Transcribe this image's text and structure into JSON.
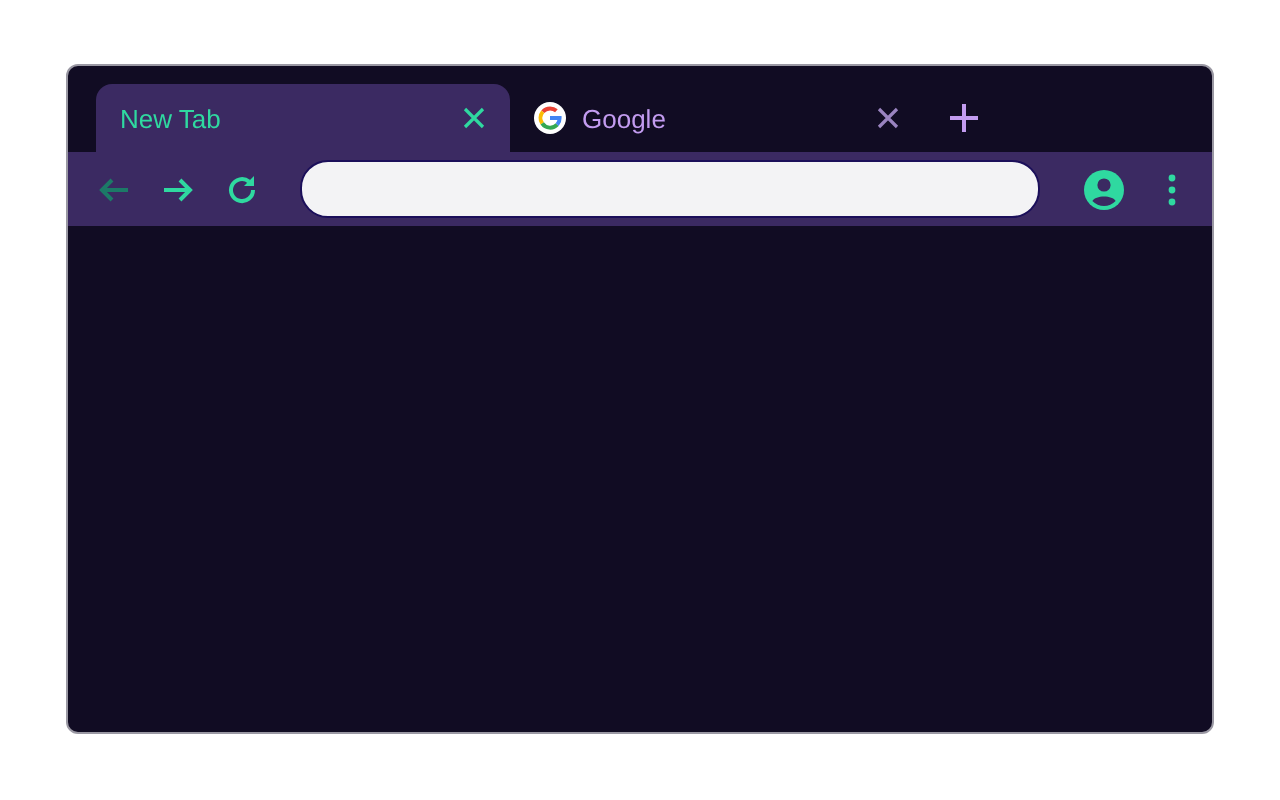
{
  "tabs": [
    {
      "title": "New Tab",
      "selected": true,
      "favicon": false
    },
    {
      "title": "Google",
      "selected": false,
      "favicon": true
    }
  ],
  "toolbar": {
    "nav_buttons": [
      {
        "kind": "back",
        "disabled": true
      },
      {
        "kind": "forward",
        "disabled": false
      },
      {
        "kind": "reload",
        "disabled": false
      }
    ]
  }
}
